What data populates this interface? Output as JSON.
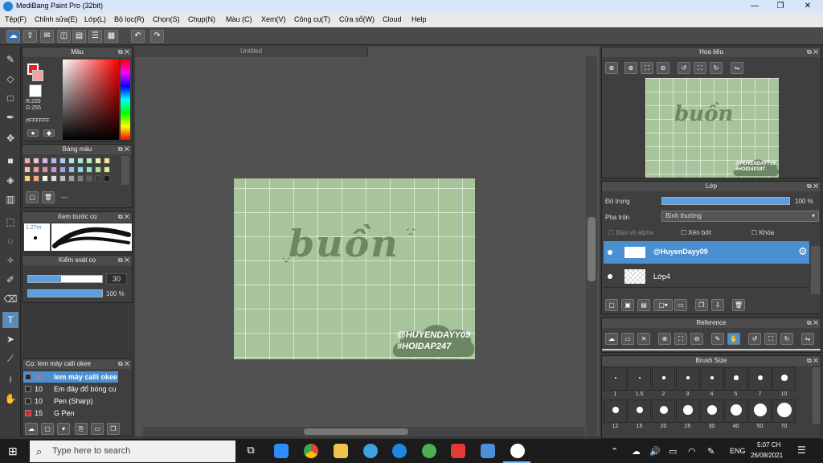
{
  "window": {
    "title": "MediBang Paint Pro (32bit)",
    "minimize": "—",
    "maximize": "❐",
    "close": "✕"
  },
  "menu": [
    "Tệp(F)",
    "Chỉnh sửa(E)",
    "Lớp(L)",
    "Bộ lọc(R)",
    "Chọn(S)",
    "Chụp(N)",
    "Màu (C)",
    "Xem(V)",
    "Công cụ(T)",
    "Cửa sổ(W)",
    "Cloud",
    "Help"
  ],
  "doc_tab": "Untitled",
  "color_panel": {
    "title": "Màu",
    "r": "R:255",
    "g": "G:255",
    "b": "B:255",
    "hex": "#FFFFFF"
  },
  "palette_panel": {
    "title": "Bảng màu",
    "more": "---",
    "colors": [
      "#f4a7a7",
      "#f2c0d0",
      "#d7b5e8",
      "#b7b9ef",
      "#aed0f3",
      "#a9e5ec",
      "#a9ecd1",
      "#b8f0b0",
      "#e7f3a6",
      "#f6df9f",
      "#f9c39d",
      "#f29b9b",
      "#e884ac",
      "#c593e0",
      "#9aa0ee",
      "#8cc3f0",
      "#86dde6",
      "#86e5bd",
      "#9ce990",
      "#dbee80",
      "#f5d27b",
      "#f7aa78",
      "#f0f0f0",
      "#dcdcdc",
      "#c0c0c0",
      "#a0a0a0",
      "#7e7e7e",
      "#5c5c5c",
      "#3c3c3c",
      "#1c1c1c"
    ]
  },
  "brush_preview": {
    "title": "Xem trước cọ",
    "size": "1.27m"
  },
  "brush_control": {
    "title": "Kiểm soát cọ",
    "size_value": "30",
    "opacity_value": "100 %",
    "size_fraction": 0.45,
    "opacity_fraction": 1.0
  },
  "brush_list": {
    "title": "Cọ: Iem mày calli okee",
    "items": [
      {
        "size": "30",
        "name": "Iem mày calli okee",
        "selected": true,
        "color": "#2a2a2a"
      },
      {
        "size": "10",
        "name": "Em đây đổ bóng cu",
        "selected": false,
        "color": "#2a2a2a"
      },
      {
        "size": "10",
        "name": "Pen (Sharp)",
        "selected": false,
        "color": "#2a2a2a"
      },
      {
        "size": "15",
        "name": "G Pen",
        "selected": false,
        "color": "#e82020"
      }
    ]
  },
  "artwork": {
    "word": "buồn",
    "tag1": "@HUYENDAYY09",
    "tag2": "#HOIDAP247"
  },
  "navigator": {
    "title": "Hoa tiêu"
  },
  "layer_panel": {
    "title": "Lớp",
    "opacity_label": "Độ trong",
    "opacity_value": "100 %",
    "opacity_fraction": 1.0,
    "blend_label": "Pha trộn",
    "blend_value": "Bình thường",
    "protect_alpha": "Bảo vệ alpha",
    "clipping": "Xén bớt",
    "lock": "Khóa",
    "layers": [
      {
        "name": "@HuyenDayy09",
        "selected": true
      },
      {
        "name": "Lớp4",
        "selected": false
      }
    ]
  },
  "reference_panel": {
    "title": "Reference"
  },
  "brush_size_panel": {
    "title": "Brush Size",
    "sizes": [
      "1",
      "1.5",
      "2",
      "3",
      "4",
      "5",
      "7",
      "10",
      "12",
      "15",
      "20",
      "25",
      "30",
      "40",
      "50",
      "70"
    ]
  },
  "taskbar": {
    "search_placeholder": "Type here to search",
    "lang": "ENG",
    "time": "5:07 CH",
    "date": "26/08/2021"
  }
}
